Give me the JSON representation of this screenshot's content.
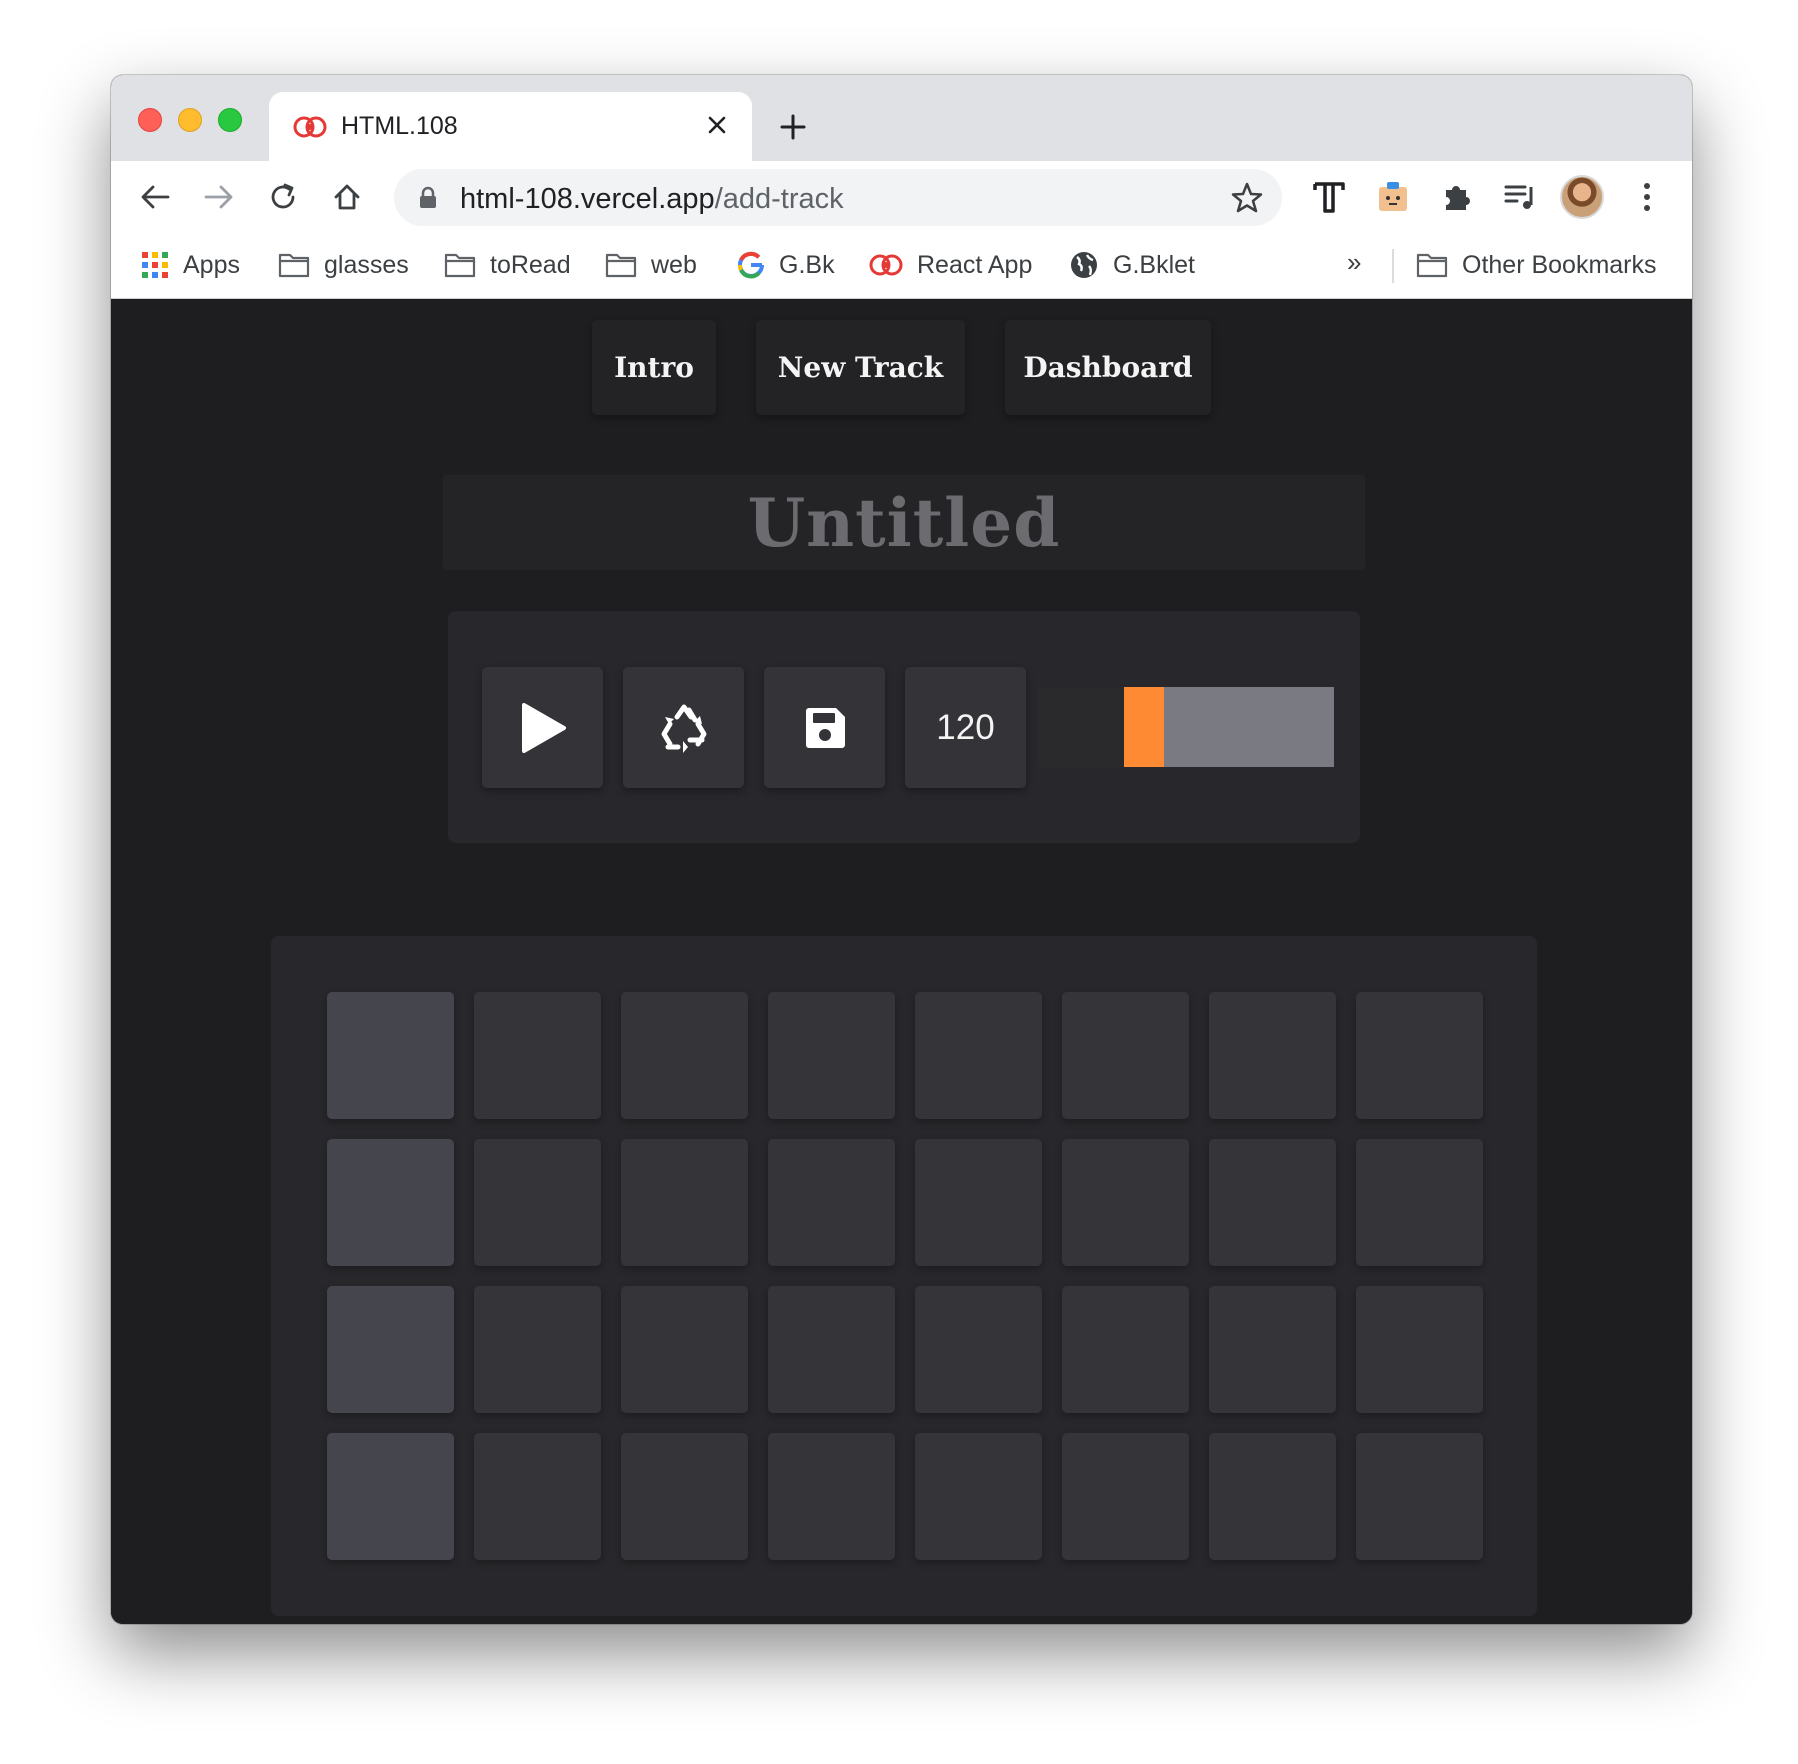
{
  "browser": {
    "tab_title": "HTML.108",
    "url_host": "html-108.vercel.app",
    "url_path": "/add-track",
    "bookmarks": [
      "Apps",
      "glasses",
      "toRead",
      "web",
      "G.Bk",
      "React App",
      "G.Bklet"
    ],
    "bookmarks_overflow": "»",
    "other_bookmarks": "Other Bookmarks"
  },
  "nav": {
    "items": [
      "Intro",
      "New Track",
      "Dashboard"
    ]
  },
  "track": {
    "title": "Untitled"
  },
  "controls": {
    "play_icon": "play-icon",
    "reset_icon": "recycle-icon",
    "save_icon": "save-icon",
    "bpm": "120",
    "slider_value_fraction": 0.29
  },
  "sequencer": {
    "rows": 4,
    "cols": 8,
    "active_column": 0
  },
  "colors": {
    "accent": "#ff8a34",
    "background": "#1e1e20",
    "panel": "#28282c",
    "cell": "#353539",
    "cell_active": "#45454d"
  }
}
